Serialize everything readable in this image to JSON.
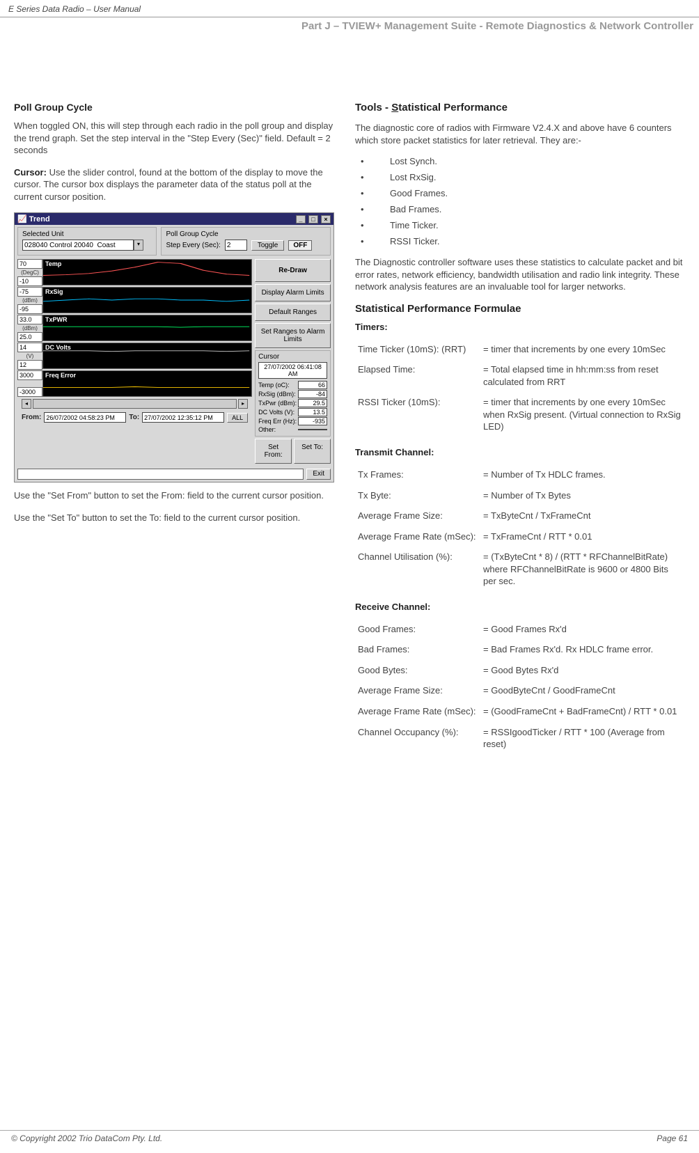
{
  "header": {
    "doc_title": "E Series Data Radio – User Manual",
    "part_title": "Part J – TVIEW+ Management Suite -  Remote Diagnostics & Network Controller"
  },
  "footer": {
    "copyright": "© Copyright 2002 Trio DataCom Pty. Ltd.",
    "page": "Page 61"
  },
  "left": {
    "h1": "Poll Group Cycle",
    "p1": "When toggled ON, this will step through each radio in the poll group and display the trend graph.  Set the step interval in the \"Step Every (Sec)\" field. Default = 2 seconds",
    "cursor_label": "Cursor:",
    "p2": "  Use the slider control, found at the bottom of the display to move the cursor.  The cursor box displays the parameter data of the status poll at the current cursor position.",
    "p3": "Use the \"Set From\" button to set the From: field to the current cursor position.",
    "p4": "Use the \"Set To\" button to set the To: field to the current cursor position."
  },
  "right": {
    "tools_pre": "Tools - ",
    "tools_u": "S",
    "tools_rest": "tatistical Performance",
    "p1": "The diagnostic core of radios with Firmware V2.4.X and above have 6 counters which store packet statistics for later retrieval.  They are:-",
    "bullets": {
      "b0": "Lost Synch.",
      "b1": "Lost RxSig.",
      "b2": "Good Frames.",
      "b3": "Bad Frames.",
      "b4": "Time Ticker.",
      "b5": "RSSI Ticker."
    },
    "p2": "The Diagnostic controller software uses these statistics to calculate packet and bit error rates, network efficiency, bandwidth utilisation and radio link integrity.  These network analysis features are an invaluable tool for larger networks.",
    "h2": "Statistical Performance Formulae",
    "timers_h": "Timers:",
    "timers": {
      "r0l": "Time Ticker (10mS): (RRT)",
      "r0v": "= timer that increments by one every 10mSec",
      "r1l": "Elapsed Time:",
      "r1v": "= Total elapsed time in hh:mm:ss from reset calculated from RRT",
      "r2l": "RSSI Ticker (10mS):",
      "r2v": "=  timer that increments by one every 10mSec when RxSig present. (Virtual connection to RxSig LED)"
    },
    "tx_h": "Transmit Channel:",
    "tx": {
      "r0l": "Tx Frames:",
      "r0v": "= Number of Tx HDLC frames.",
      "r1l": "Tx  Byte:",
      "r1v": "= Number of Tx Bytes",
      "r2l": "Average Frame Size:",
      "r2v": "= TxByteCnt / TxFrameCnt",
      "r3l": "Average Frame Rate (mSec):",
      "r3v": "= TxFrameCnt / RTT * 0.01",
      "r4l": "Channel Utilisation (%):",
      "r4v": "= (TxByteCnt * 8) / (RTT * RFChannelBitRate)\nwhere RFChannelBitRate is 9600 or 4800 Bits per sec."
    },
    "rx_h": "Receive Channel:",
    "rx": {
      "r0l": "Good Frames:",
      "r0v": "= Good Frames Rx'd",
      "r1l": "Bad Frames:",
      "r1v": "= Bad Frames Rx'd. Rx HDLC frame error.",
      "r2l": "Good Bytes:",
      "r2v": "= Good Bytes Rx'd",
      "r3l": "Average Frame Size:",
      "r3v": "= GoodByteCnt / GoodFrameCnt",
      "r4l": "Average Frame Rate (mSec):",
      "r4v": "= (GoodFrameCnt + BadFrameCnt) / RTT * 0.01",
      "r5l": "Channel Occupancy (%):",
      "r5v": "= RSSIgoodTicker / RTT * 100 (Average from reset)"
    }
  },
  "trend": {
    "title": "Trend",
    "selected_unit_legend": "Selected Unit",
    "selected_unit_value": "028040 Control 20040  Coast",
    "poll_cycle_legend": "Poll Group Cycle",
    "step_label": "Step Every (Sec):",
    "step_value": "2",
    "toggle_label": "Toggle",
    "off_label": "OFF",
    "btn_redraw": "Re-Draw",
    "btn_alarm": "Display Alarm Limits",
    "btn_default": "Default Ranges",
    "btn_setranges": "Set Ranges to Alarm Limits",
    "cursor_legend": "Cursor",
    "cursor_date": "27/07/2002 06:41:08 AM",
    "c_temp_l": "Temp (oC):",
    "c_temp_v": "66",
    "c_rx_l": "RxSig (dBm):",
    "c_rx_v": "-84",
    "c_tx_l": "TxPwr (dBm):",
    "c_tx_v": "29.5",
    "c_dc_l": "DC Volts (V):",
    "c_dc_v": "13.5",
    "c_freq_l": "Freq Err (Hz):",
    "c_freq_v": "-935",
    "c_other_l": "Other:",
    "c_other_v": "",
    "from_label": "From:",
    "from_value": "26/07/2002 04:58:23 PM",
    "to_label": "To:",
    "to_value": "27/07/2002 12:35:12 PM",
    "btn_all": "ALL",
    "btn_setfrom": "Set From:",
    "btn_setto": "Set To:",
    "btn_exit": "Exit",
    "charts": {
      "temp": {
        "title": "Temp",
        "unit": "(DegC)",
        "hi": "70",
        "lo": "-10"
      },
      "rx": {
        "title": "RxSig",
        "unit": "(dBm)",
        "hi": "-75",
        "lo": "-95"
      },
      "tx": {
        "title": "TxPWR",
        "unit": "(dBm)",
        "hi": "33.0",
        "lo": "25.0"
      },
      "dc": {
        "title": "DC Volts",
        "unit": "(V)",
        "hi": "14",
        "lo": "12"
      },
      "freq": {
        "title": "Freq Error",
        "unit": "",
        "hi": "3000",
        "lo": "-3000"
      }
    }
  },
  "chart_data": [
    {
      "type": "line",
      "title": "Temp",
      "ylabel": "(DegC)",
      "ylim": [
        -10,
        70
      ],
      "series": [
        {
          "name": "Temp",
          "color": "#ff5555",
          "values": [
            24,
            26,
            30,
            38,
            50,
            66,
            62,
            40,
            28,
            24
          ]
        }
      ],
      "x": [
        0,
        1,
        2,
        3,
        4,
        5,
        6,
        7,
        8,
        9
      ]
    },
    {
      "type": "line",
      "title": "RxSig",
      "ylabel": "(dBm)",
      "ylim": [
        -95,
        -75
      ],
      "series": [
        {
          "name": "RxSig",
          "color": "#00c0ff",
          "values": [
            -86,
            -85,
            -84,
            -85,
            -84,
            -84,
            -85,
            -85,
            -86,
            -85
          ]
        }
      ],
      "x": [
        0,
        1,
        2,
        3,
        4,
        5,
        6,
        7,
        8,
        9
      ]
    },
    {
      "type": "line",
      "title": "TxPWR",
      "ylabel": "(dBm)",
      "ylim": [
        25,
        33
      ],
      "series": [
        {
          "name": "TxPWR",
          "color": "#00ff66",
          "values": [
            29.6,
            29.5,
            29.5,
            29.5,
            29.5,
            29.5,
            29.4,
            29.5,
            29.5,
            29.5
          ]
        }
      ],
      "x": [
        0,
        1,
        2,
        3,
        4,
        5,
        6,
        7,
        8,
        9
      ]
    },
    {
      "type": "line",
      "title": "DC Volts",
      "ylabel": "(V)",
      "ylim": [
        12,
        14
      ],
      "series": [
        {
          "name": "DC Volts",
          "color": "#cccccc",
          "values": [
            13.5,
            13.5,
            13.5,
            13.4,
            13.5,
            13.5,
            13.5,
            13.5,
            13.4,
            13.5
          ]
        }
      ],
      "x": [
        0,
        1,
        2,
        3,
        4,
        5,
        6,
        7,
        8,
        9
      ]
    },
    {
      "type": "line",
      "title": "Freq Error",
      "ylabel": "(Hz)",
      "ylim": [
        -3000,
        3000
      ],
      "series": [
        {
          "name": "Freq Error",
          "color": "#ffcc00",
          "values": [
            -950,
            -940,
            -930,
            -935,
            -920,
            -935,
            -940,
            -930,
            -935,
            -940
          ]
        }
      ],
      "x": [
        0,
        1,
        2,
        3,
        4,
        5,
        6,
        7,
        8,
        9
      ]
    }
  ]
}
